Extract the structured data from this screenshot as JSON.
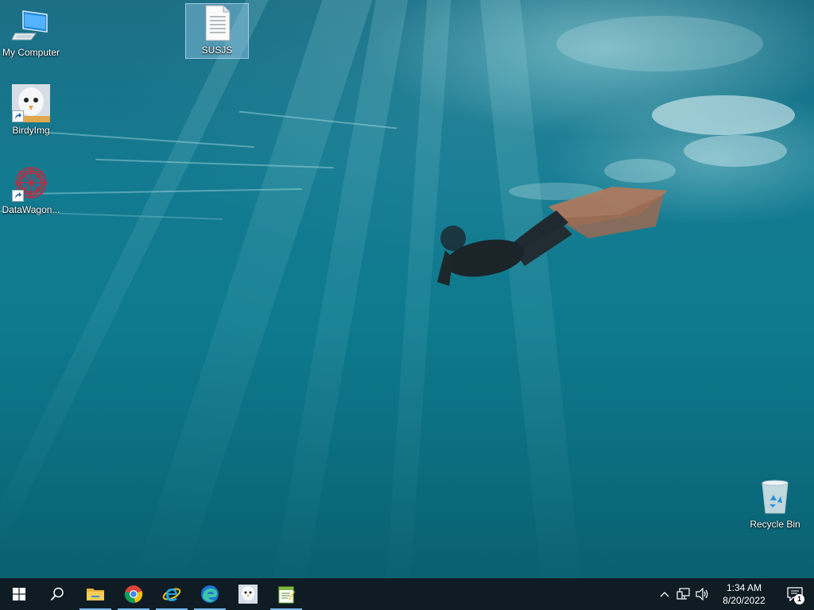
{
  "desktop": {
    "icons": [
      {
        "label": "My Computer",
        "icon": "computer-icon"
      },
      {
        "label": "BirdyImg",
        "icon": "birdyimg-icon",
        "shortcut": true
      },
      {
        "label": "DataWagon...",
        "icon": "datawagon-icon",
        "shortcut": true
      },
      {
        "label": "SUSJS",
        "icon": "text-document-icon",
        "selected": true
      },
      {
        "label": "Recycle Bin",
        "icon": "recycle-bin-icon"
      }
    ]
  },
  "taskbar": {
    "pinned": [
      {
        "name": "start",
        "icon": "windows-logo-icon"
      },
      {
        "name": "search",
        "icon": "search-icon"
      },
      {
        "name": "file-explorer",
        "icon": "folder-icon",
        "active": true
      },
      {
        "name": "chrome",
        "icon": "chrome-icon",
        "active": true
      },
      {
        "name": "internet-explorer",
        "icon": "internet-explorer-icon",
        "active": true
      },
      {
        "name": "edge",
        "icon": "edge-icon",
        "active": true
      },
      {
        "name": "birdyimg",
        "icon": "birdyimg-icon"
      },
      {
        "name": "notepad-plus",
        "icon": "notepad-icon",
        "active": true
      }
    ],
    "tray": {
      "time": "1:34 AM",
      "date": "8/20/2022",
      "notification_count": "1"
    }
  },
  "colors": {
    "taskbar_bg": "#0f1c24",
    "active_indicator": "#76b9ed",
    "water_mid": "#0f7a8e"
  }
}
